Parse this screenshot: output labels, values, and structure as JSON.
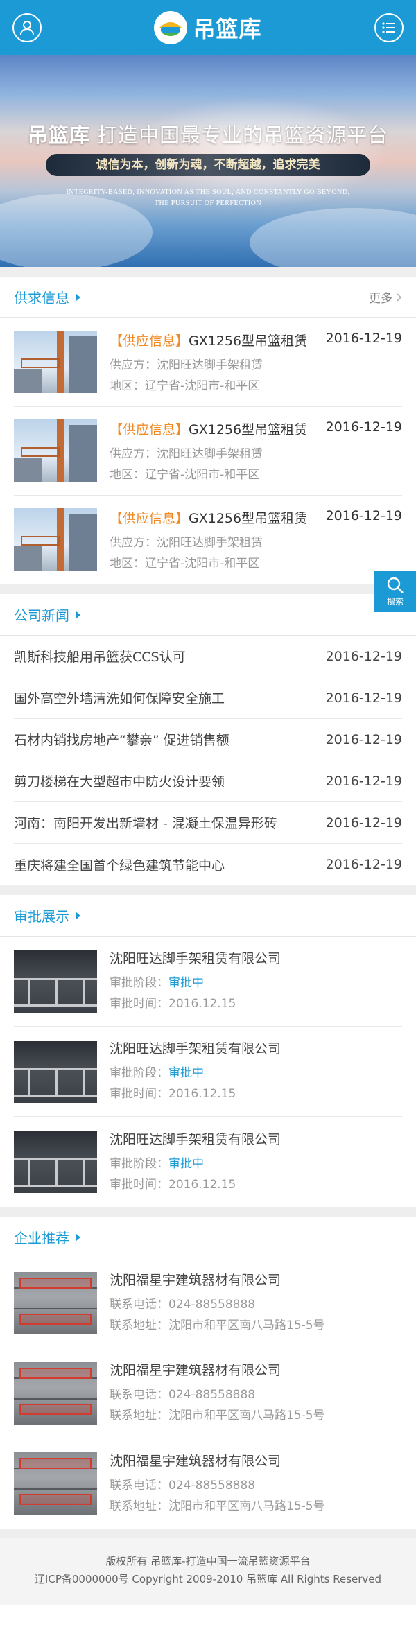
{
  "header": {
    "logo_text": "吊篮库",
    "user_icon": "user-icon",
    "menu_icon": "menu-list-icon"
  },
  "banner": {
    "title_brand": "吊篮库",
    "title_rest": "打造中国最专业的吊篮资源平台",
    "slogan": "诚信为本，创新为魂，不断超越，追求完美",
    "english_line1": "INTEGRITY-BASED, INNOVATION AS THE SOUL, AND CONSTANTLY GO BEYOND,",
    "english_line2": "THE PURSUIT OF PERFECTION"
  },
  "supply": {
    "title": "供求信息",
    "more": "更多",
    "items": [
      {
        "tag": "【供应信息】",
        "title": "GX1256型吊篮租赁",
        "date": "2016-12-19",
        "supplier": "供应方：沈阳旺达脚手架租赁",
        "region": "地区：辽宁省-沈阳市-和平区"
      },
      {
        "tag": "【供应信息】",
        "title": "GX1256型吊篮租赁",
        "date": "2016-12-19",
        "supplier": "供应方：沈阳旺达脚手架租赁",
        "region": "地区：辽宁省-沈阳市-和平区"
      },
      {
        "tag": "【供应信息】",
        "title": "GX1256型吊篮租赁",
        "date": "2016-12-19",
        "supplier": "供应方：沈阳旺达脚手架租赁",
        "region": "地区：辽宁省-沈阳市-和平区"
      }
    ]
  },
  "news": {
    "title": "公司新闻",
    "items": [
      {
        "title": "凯斯科技船用吊篮获CCS认可",
        "date": "2016-12-19"
      },
      {
        "title": "国外高空外墙清洗如何保障安全施工",
        "date": "2016-12-19"
      },
      {
        "title": "石材内销找房地产“攀亲” 促进销售额",
        "date": "2016-12-19"
      },
      {
        "title": "剪刀楼梯在大型超市中防火设计要领",
        "date": "2016-12-19"
      },
      {
        "title": "河南：南阳开发出新墙材 - 混凝土保温异形砖",
        "date": "2016-12-19"
      },
      {
        "title": "重庆将建全国首个绿色建筑节能中心",
        "date": "2016-12-19"
      }
    ]
  },
  "approval": {
    "title": "审批展示",
    "items": [
      {
        "name": "沈阳旺达脚手架租赁有限公司",
        "stage_label": "审批阶段：",
        "stage": "审批中",
        "time": "审批时间：2016.12.15"
      },
      {
        "name": "沈阳旺达脚手架租赁有限公司",
        "stage_label": "审批阶段：",
        "stage": "审批中",
        "time": "审批时间：2016.12.15"
      },
      {
        "name": "沈阳旺达脚手架租赁有限公司",
        "stage_label": "审批阶段：",
        "stage": "审批中",
        "time": "审批时间：2016.12.15"
      }
    ]
  },
  "enterprise": {
    "title": "企业推荐",
    "items": [
      {
        "name": "沈阳福星宇建筑器材有限公司",
        "phone": "联系电话：024-88558888",
        "address": "联系地址：沈阳市和平区南八马路15-5号"
      },
      {
        "name": "沈阳福星宇建筑器材有限公司",
        "phone": "联系电话：024-88558888",
        "address": "联系地址：沈阳市和平区南八马路15-5号"
      },
      {
        "name": "沈阳福星宇建筑器材有限公司",
        "phone": "联系电话：024-88558888",
        "address": "联系地址：沈阳市和平区南八马路15-5号"
      }
    ]
  },
  "float_search": {
    "label": "搜索",
    "icon": "search-icon"
  },
  "footer": {
    "line1": "版权所有 吊篮库-打造中国一流吊篮资源平台",
    "line2": "辽ICP备0000000号 Copyright 2009-2010 吊篮库 All Rights Reserved"
  },
  "colors": {
    "brand_blue": "#1b9ad6",
    "tag_orange": "#f08a24"
  }
}
